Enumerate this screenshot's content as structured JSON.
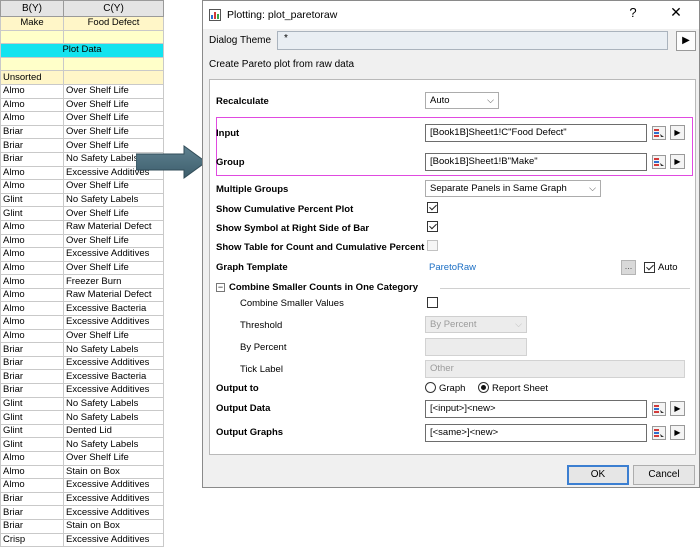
{
  "sheet": {
    "columns": [
      "B(Y)",
      "C(Y)"
    ],
    "long_names": [
      "Make",
      "Food Defect"
    ],
    "blank_row": [
      "",
      ""
    ],
    "plot_data_label": "Plot Data",
    "blank_row2": [
      "",
      ""
    ],
    "unsorted_label": "Unsorted",
    "rows": [
      [
        "Almo",
        "Over Shelf Life"
      ],
      [
        "Almo",
        "Over Shelf Life"
      ],
      [
        "Almo",
        "Over Shelf Life"
      ],
      [
        "Briar",
        "Over Shelf Life"
      ],
      [
        "Briar",
        "Over Shelf Life"
      ],
      [
        "Briar",
        "No Safety Labels"
      ],
      [
        "Almo",
        "Excessive Additives"
      ],
      [
        "Almo",
        "Over Shelf Life"
      ],
      [
        "Glint",
        "No Safety Labels"
      ],
      [
        "Glint",
        "Over Shelf Life"
      ],
      [
        "Almo",
        "Raw Material Defect"
      ],
      [
        "Almo",
        "Over Shelf Life"
      ],
      [
        "Almo",
        "Excessive Additives"
      ],
      [
        "Almo",
        "Over Shelf Life"
      ],
      [
        "Almo",
        "Freezer Burn"
      ],
      [
        "Almo",
        "Raw Material Defect"
      ],
      [
        "Almo",
        "Excessive Bacteria"
      ],
      [
        "Almo",
        "Excessive Additives"
      ],
      [
        "Almo",
        "Over Shelf Life"
      ],
      [
        "Briar",
        "No Safety Labels"
      ],
      [
        "Briar",
        "Excessive Additives"
      ],
      [
        "Briar",
        "Excessive Bacteria"
      ],
      [
        "Briar",
        "Excessive Additives"
      ],
      [
        "Glint",
        "No Safety Labels"
      ],
      [
        "Glint",
        "No Safety Labels"
      ],
      [
        "Glint",
        "Dented Lid"
      ],
      [
        "Glint",
        "No Safety Labels"
      ],
      [
        "Almo",
        "Over Shelf Life"
      ],
      [
        "Almo",
        "Stain on Box"
      ],
      [
        "Almo",
        "Excessive Additives"
      ],
      [
        "Briar",
        "Excessive Additives"
      ],
      [
        "Briar",
        "Excessive Additives"
      ],
      [
        "Briar",
        "Stain on Box"
      ],
      [
        "Crisp",
        "Excessive Additives"
      ]
    ]
  },
  "dialog": {
    "title": "Plotting: plot_paretoraw",
    "help_label": "?",
    "close_label": "✕",
    "theme_label": "Dialog Theme",
    "theme_value": "*",
    "theme_button": "▶",
    "description": "Create Pareto plot from raw data",
    "recalculate": {
      "label": "Recalculate",
      "value": "Auto"
    },
    "input": {
      "label": "Input",
      "value": "[Book1B]Sheet1!C\"Food Defect\""
    },
    "group": {
      "label": "Group",
      "value": "[Book1B]Sheet1!B\"Make\""
    },
    "multiple_groups": {
      "label": "Multiple Groups",
      "value": "Separate Panels in Same Graph"
    },
    "show_cumulative": {
      "label": "Show Cumulative Percent Plot",
      "checked": true
    },
    "show_symbol": {
      "label": "Show Symbol at Right Side of Bar",
      "checked": true
    },
    "show_table": {
      "label": "Show Table for Count and Cumulative Percent",
      "checked": false
    },
    "graph_template": {
      "label": "Graph Template",
      "value": "ParetoRaw",
      "browse": "...",
      "auto_label": "Auto",
      "auto_checked": true
    },
    "combine_section": {
      "label": "Combine Smaller Counts in One Category",
      "toggle": "−"
    },
    "combine_values": {
      "label": "Combine Smaller Values",
      "checked": false
    },
    "threshold": {
      "label": "Threshold",
      "value": "By Percent"
    },
    "by_percent": {
      "label": "By Percent",
      "value": ""
    },
    "tick_label": {
      "label": "Tick Label",
      "value": "Other"
    },
    "output_to": {
      "label": "Output to",
      "option_graph": "Graph",
      "option_report": "Report Sheet",
      "selected": "Report Sheet"
    },
    "output_data": {
      "label": "Output Data",
      "value": "[<input>]<new>"
    },
    "output_graphs": {
      "label": "Output Graphs",
      "value": "[<same>]<new>"
    },
    "ok_label": "OK",
    "cancel_label": "Cancel",
    "arrow_button_glyph": "▶"
  }
}
